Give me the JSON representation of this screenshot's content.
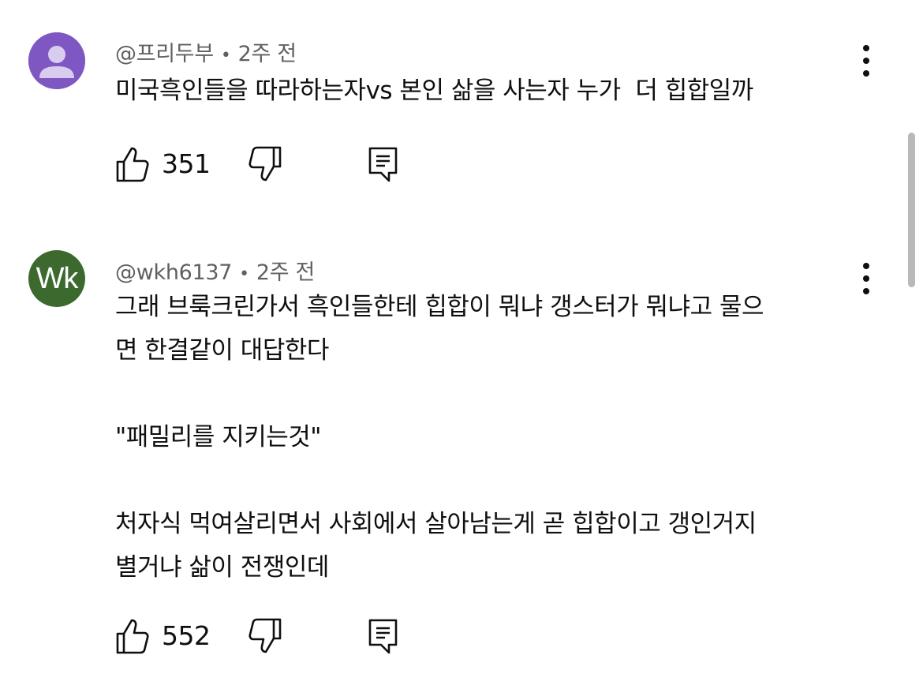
{
  "comments": [
    {
      "avatar_color": "#7e57c2",
      "author": "@프리두부",
      "separator": "•",
      "time": "2주 전",
      "text": "미국흑인들을 따라하는자vs 본인 삶을 사는자 누가  더 힙합일까",
      "likes": "351",
      "icons": [
        "thumb-up-icon",
        "thumb-down-icon",
        "reply-icon",
        "more-vert-icon"
      ]
    },
    {
      "avatar_color": "#3c6a2e",
      "avatar_initials": "Wk",
      "author": "@wkh6137",
      "separator": "•",
      "time": "2주 전",
      "text": "그래 브룩크린가서 흑인들한테 힙합이 뭐냐 갱스터가 뭐냐고 물으\n면 한결같이 대답한다\n\n\"패밀리를 지키는것\"\n\n처자식 먹여살리면서 사회에서 살아남는게 곧 힙합이고 갱인거지\n별거냐 삶이 전쟁인데",
      "likes": "552",
      "icons": [
        "thumb-up-icon",
        "thumb-down-icon",
        "reply-icon",
        "more-vert-icon"
      ]
    }
  ]
}
